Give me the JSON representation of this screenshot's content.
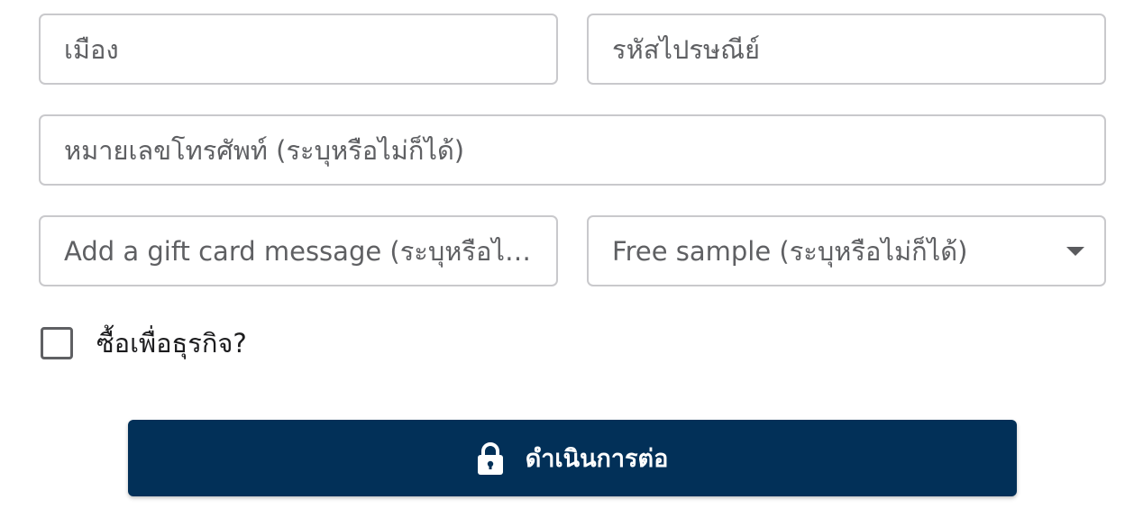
{
  "form": {
    "city_placeholder": "เมือง",
    "postal_placeholder": "รหัสไปรษณีย์",
    "phone_placeholder": "หมายเลขโทรศัพท์ (ระบุหรือไม่ก็ได้)",
    "gift_message_placeholder": "Add a gift card message (ระบุหรือไม่ก็ได้)",
    "free_sample_placeholder": "Free sample (ระบุหรือไม่ก็ได้)",
    "business_checkbox_label": "ซื้อเพื่อธุรกิจ?",
    "business_checked": false
  },
  "submit": {
    "label": "ดำเนินการต่อ",
    "icon": "lock-icon"
  },
  "colors": {
    "button_bg": "#023058",
    "border": "#c9c9cc",
    "placeholder": "#5f6063"
  }
}
